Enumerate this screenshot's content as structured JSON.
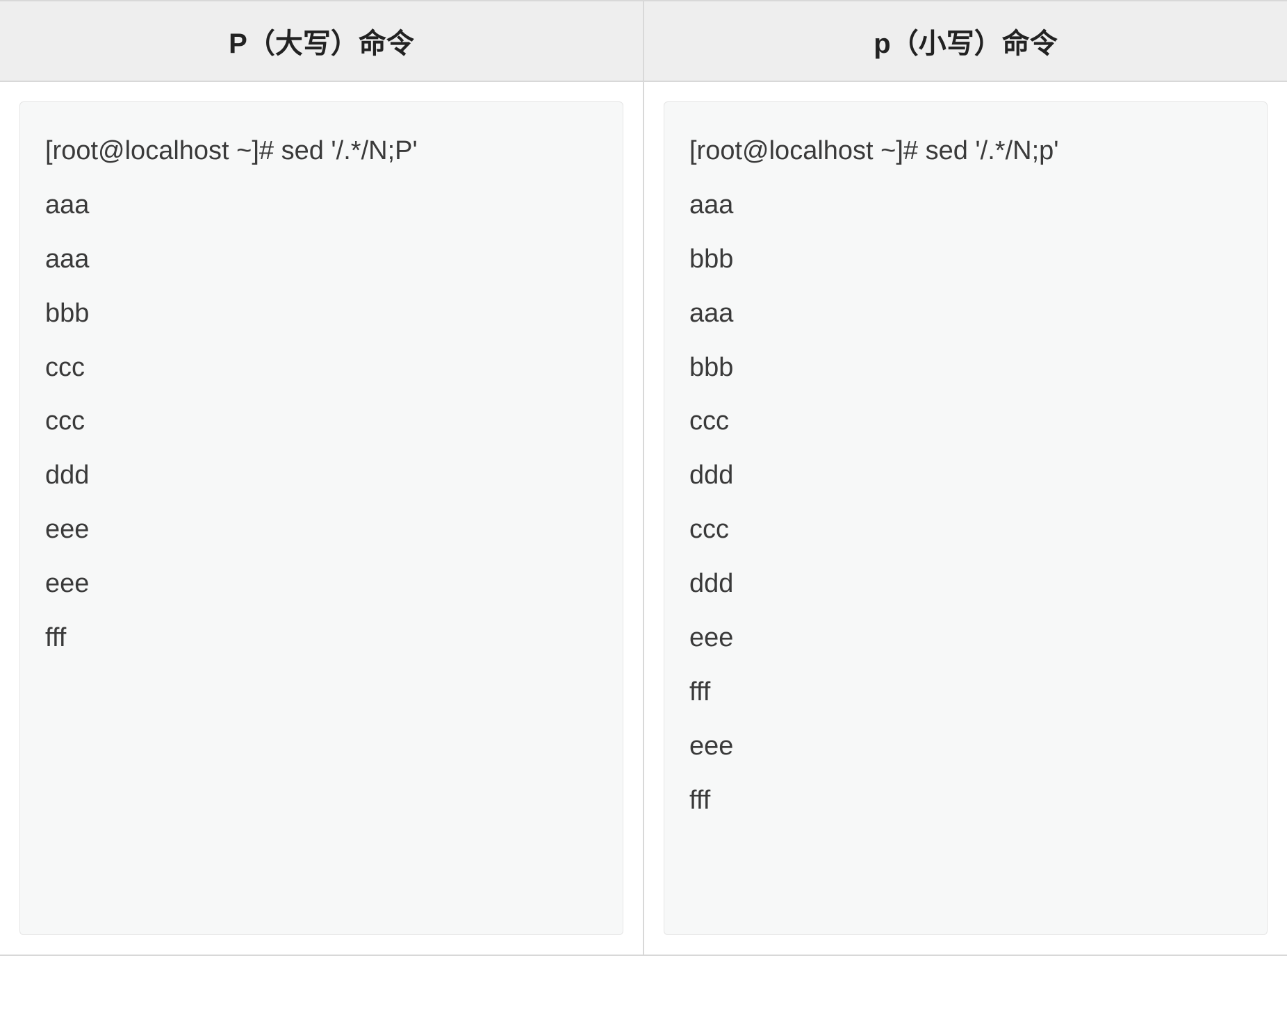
{
  "table": {
    "headers": [
      "P（大写）命令",
      "p（小写）命令"
    ],
    "columns": [
      {
        "lines": [
          "[root@localhost ~]# sed '/.*/N;P'",
          "aaa",
          "aaa",
          "bbb",
          "ccc",
          "ccc",
          "ddd",
          "eee",
          "eee",
          "fff"
        ]
      },
      {
        "lines": [
          "[root@localhost ~]# sed '/.*/N;p'",
          "aaa",
          "bbb",
          "aaa",
          "bbb",
          "ccc",
          "ddd",
          "ccc",
          "ddd",
          "eee",
          "fff",
          "eee",
          "fff"
        ]
      }
    ]
  }
}
